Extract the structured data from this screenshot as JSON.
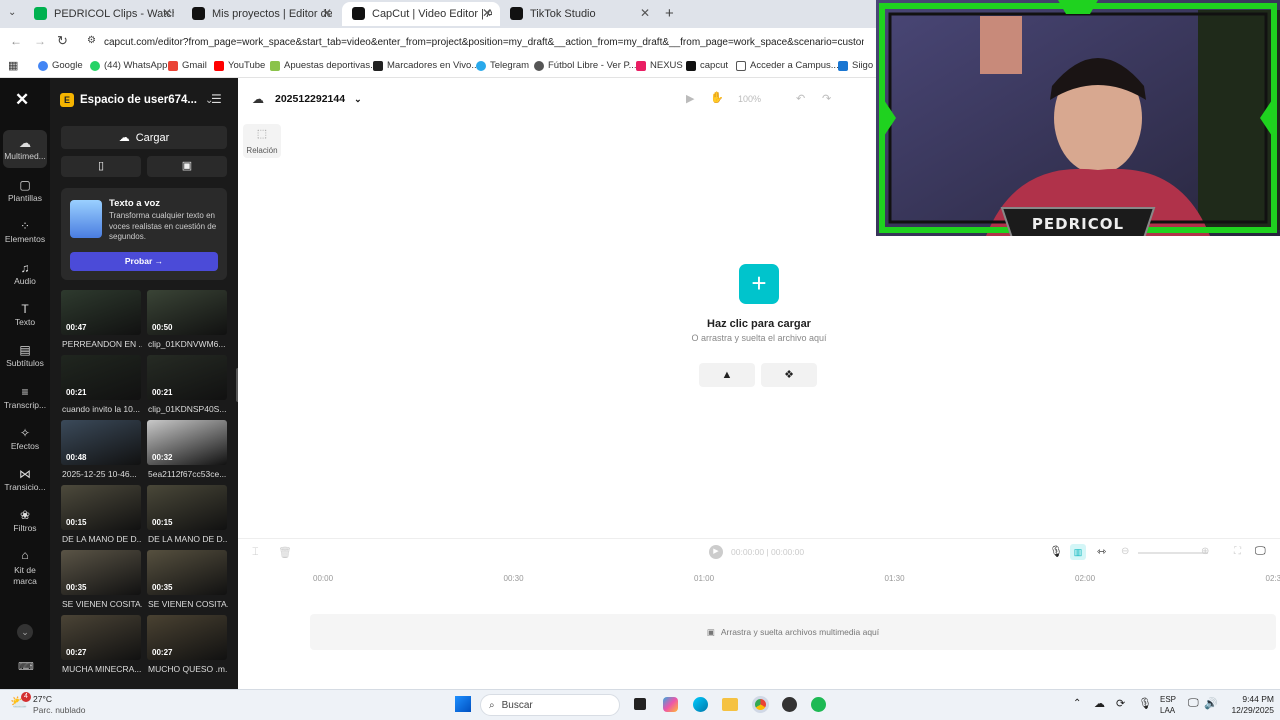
{
  "browser": {
    "tabs": [
      {
        "label": "PEDRICOL Clips - Watch Live o",
        "color": "#00b14f"
      },
      {
        "label": "Mis proyectos | Editor de video",
        "color": "#111111"
      },
      {
        "label": "CapCut | Video Editor | All-In-O",
        "color": "#111111"
      },
      {
        "label": "TikTok Studio",
        "color": "#111111"
      }
    ],
    "new_tab": "+",
    "url": "capcut.com/editor?from_page=work_space&start_tab=video&enter_from=project&position=my_draft&__action_from=my_draft&__from_page=work_space&scenario=custom",
    "bookmarks": [
      "Google",
      "(44) WhatsApp",
      "Gmail",
      "YouTube",
      "Apuestas deportivas...",
      "Marcadores en Vivo...",
      "Telegram",
      "Fútbol Libre - Ver P...",
      "NEXUS",
      "capcut",
      "Acceder a Campus...",
      "Siigo P"
    ]
  },
  "workspace": {
    "name": "Espacio de user674...",
    "badge": "E",
    "project_name": "202512292144",
    "zoom": "100%"
  },
  "nav": [
    {
      "label": "Multimed...",
      "icon": "cloud-upload-icon"
    },
    {
      "label": "Plantillas",
      "icon": "template-icon"
    },
    {
      "label": "Elementos",
      "icon": "elements-icon"
    },
    {
      "label": "Audio",
      "icon": "audio-icon"
    },
    {
      "label": "Texto",
      "icon": "text-icon"
    },
    {
      "label": "Subtítulos",
      "icon": "subtitles-icon"
    },
    {
      "label": "Transcrip...",
      "icon": "transcript-icon"
    },
    {
      "label": "Efectos",
      "icon": "effects-icon"
    },
    {
      "label": "Transicio...",
      "icon": "transition-icon"
    },
    {
      "label": "Filtros",
      "icon": "filters-icon"
    },
    {
      "label": "Kit de marca",
      "icon": "brand-kit-icon"
    }
  ],
  "panel": {
    "upload_label": "Cargar",
    "promo_title": "Texto a voz",
    "promo_body": "Transforma cualquier texto en voces realistas en cuestión de segundos.",
    "promo_button": "Probar →",
    "clips": [
      {
        "duration": "00:47",
        "title": "PERREANDON EN ..."
      },
      {
        "duration": "00:50",
        "title": "clip_01KDNVWM6..."
      },
      {
        "duration": "00:21",
        "title": "cuando invito la 10..."
      },
      {
        "duration": "00:21",
        "title": "clip_01KDNSP40S..."
      },
      {
        "duration": "00:48",
        "title": "2025-12-25 10-46..."
      },
      {
        "duration": "00:32",
        "title": "5ea2112f67cc53ce..."
      },
      {
        "duration": "00:15",
        "title": "DE LA MANO DE D..."
      },
      {
        "duration": "00:15",
        "title": "DE LA MANO DE D..."
      },
      {
        "duration": "00:35",
        "title": "SE VIENEN COSITA..."
      },
      {
        "duration": "00:35",
        "title": "SE VIENEN COSITA..."
      },
      {
        "duration": "00:27",
        "title": "MUCHA MINECRA..."
      },
      {
        "duration": "00:27",
        "title": "MUCHO QUESO .m..."
      }
    ]
  },
  "canvas": {
    "ratio_label": "Relación",
    "upload_title": "Haz clic para cargar",
    "upload_sub": "O arrastra y suelta el archivo aquí",
    "timecode": "00:00:00 | 00:00:00",
    "ruler": [
      "00:00",
      "00:30",
      "01:00",
      "01:30",
      "02:00",
      "02:3"
    ],
    "drop_hint": "Arrastra y suelta archivos multimedia aquí"
  },
  "taskbar": {
    "weather_temp": "27°C",
    "weather_desc": "Parc. nublado",
    "weather_badge": "4",
    "search": "Buscar",
    "lang_top": "ESP",
    "lang_bottom": "LAA",
    "time": "9:44 PM",
    "date": "12/29/2025"
  },
  "overlay": {
    "name": "PEDRICOL"
  },
  "colors": {
    "accent": "#00c4cc",
    "promo": "#4b4bd8",
    "cam_green": "#1fd21f"
  }
}
